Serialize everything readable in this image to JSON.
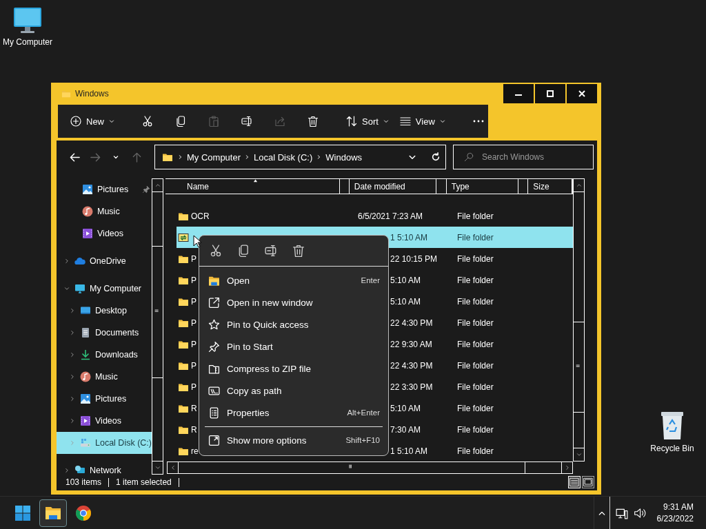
{
  "desktop_icons": [
    {
      "kind": "computer",
      "label": "My Computer"
    },
    {
      "kind": "recycle",
      "label": "Recycle Bin"
    }
  ],
  "window": {
    "title": "Windows"
  },
  "toolbar": [
    [
      {
        "kind": "new",
        "label": "New",
        "disabled": false
      }
    ],
    [
      {
        "kind": "cut",
        "disabled": false
      },
      {
        "kind": "copy",
        "disabled": false
      },
      {
        "kind": "paste",
        "disabled": true
      },
      {
        "kind": "rename",
        "disabled": false
      },
      {
        "kind": "share",
        "disabled": true
      },
      {
        "kind": "delete",
        "disabled": false
      }
    ],
    [
      {
        "kind": "sort",
        "label": "Sort",
        "disabled": false
      },
      {
        "kind": "view",
        "label": "View",
        "disabled": false
      }
    ],
    [
      {
        "kind": "more",
        "disabled": false
      }
    ]
  ],
  "nav_buttons": [
    {
      "kind": "back",
      "disabled": false
    },
    {
      "kind": "forward",
      "disabled": true
    },
    {
      "kind": "recent",
      "disabled": false
    },
    {
      "kind": "up",
      "disabled": true
    }
  ],
  "address": {
    "crumbs": [
      "My Computer",
      "Local Disk (C:)",
      "Windows"
    ]
  },
  "search": {
    "placeholder": "Search Windows"
  },
  "sidebar": {
    "pinned": [
      {
        "kind": "pictures",
        "label": "Pictures",
        "pinned": true
      },
      {
        "kind": "music",
        "label": "Music",
        "pinned": false
      },
      {
        "kind": "videos",
        "label": "Videos",
        "pinned": false
      }
    ],
    "tree": [
      {
        "kind": "onedrive",
        "label": "OneDrive",
        "expanded": false,
        "selected": false
      },
      {
        "kind": "computer",
        "label": "My Computer",
        "expanded": true,
        "selected": false,
        "children": [
          {
            "kind": "desktop",
            "label": "Desktop",
            "expanded": false,
            "selected": false
          },
          {
            "kind": "documents",
            "label": "Documents",
            "expanded": false,
            "selected": false
          },
          {
            "kind": "downloads",
            "label": "Downloads",
            "expanded": false,
            "selected": false
          },
          {
            "kind": "music",
            "label": "Music",
            "expanded": false,
            "selected": false
          },
          {
            "kind": "pictures",
            "label": "Pictures",
            "expanded": false,
            "selected": false
          },
          {
            "kind": "videos",
            "label": "Videos",
            "expanded": false,
            "selected": false
          },
          {
            "kind": "drive",
            "label": "Local Disk (C:)",
            "expanded": false,
            "selected": true
          }
        ]
      },
      {
        "kind": "network",
        "label": "Network",
        "expanded": false,
        "selected": false
      }
    ]
  },
  "table": {
    "columns": [
      {
        "label": "Name",
        "sorted": true
      },
      {
        "label": "Date modified",
        "sorted": false
      },
      {
        "label": "Type",
        "sorted": false
      },
      {
        "label": "Size",
        "sorted": false
      }
    ],
    "rows": [
      {
        "kind": "folder",
        "name": "OCR",
        "date": "6/5/2021 7:23 AM",
        "type": "File folder",
        "selected": false
      },
      {
        "kind": "sync-folder",
        "date": "1 5:10 AM",
        "type": "File folder",
        "selected": true,
        "date_covered": true
      },
      {
        "kind": "folder",
        "name": "P",
        "date": "22 10:15 PM",
        "type": "File folder",
        "selected": false,
        "date_covered": true
      },
      {
        "kind": "folder",
        "name": "P",
        "date": "5:10 AM",
        "type": "File folder",
        "selected": false,
        "date_covered": true
      },
      {
        "kind": "folder",
        "name": "P",
        "date": "5:10 AM",
        "type": "File folder",
        "selected": false,
        "date_covered": true
      },
      {
        "kind": "folder",
        "name": "P",
        "date": "22 4:30 PM",
        "type": "File folder",
        "selected": false,
        "date_covered": true
      },
      {
        "kind": "folder",
        "name": "P",
        "date": "22 9:30 AM",
        "type": "File folder",
        "selected": false,
        "date_covered": true
      },
      {
        "kind": "folder",
        "name": "P",
        "date": "22 4:30 PM",
        "type": "File folder",
        "selected": false,
        "date_covered": true
      },
      {
        "kind": "folder",
        "name": "P",
        "date": "22 3:30 PM",
        "type": "File folder",
        "selected": false,
        "date_covered": true
      },
      {
        "kind": "folder",
        "name": "R",
        "date": "5:10 AM",
        "type": "File folder",
        "selected": false,
        "date_covered": true
      },
      {
        "kind": "folder",
        "name": "R",
        "date": "7:30 AM",
        "type": "File folder",
        "selected": false,
        "date_covered": true
      },
      {
        "kind": "folder",
        "name": "re",
        "date": "1 5:10 AM",
        "type": "File folder",
        "selected": false,
        "date_covered": true
      }
    ]
  },
  "status_bar": {
    "items": [
      "103 items",
      "1 item selected"
    ],
    "views": [
      {
        "kind": "details",
        "selected": true
      },
      {
        "kind": "tiles",
        "selected": false
      }
    ]
  },
  "context_menu": {
    "quick_actions": [
      {
        "kind": "cut"
      },
      {
        "kind": "copy"
      },
      {
        "kind": "rename"
      },
      {
        "kind": "delete"
      }
    ],
    "sections": [
      [
        {
          "kind": "open",
          "label": "Open",
          "shortcut": "Enter"
        },
        {
          "kind": "new-window",
          "label": "Open in new window"
        },
        {
          "kind": "star",
          "label": "Pin to Quick access"
        },
        {
          "kind": "pin",
          "label": "Pin to Start"
        },
        {
          "kind": "zip",
          "label": "Compress to ZIP file"
        },
        {
          "kind": "path",
          "label": "Copy as path"
        },
        {
          "kind": "properties",
          "label": "Properties",
          "shortcut": "Alt+Enter"
        }
      ],
      [
        {
          "kind": "more-options",
          "label": "Show more options",
          "shortcut": "Shift+F10"
        }
      ]
    ]
  },
  "taskbar": {
    "apps": [
      {
        "kind": "start",
        "active": false
      },
      {
        "kind": "explorer",
        "active": true
      },
      {
        "kind": "chrome",
        "active": false
      }
    ],
    "time": "9:31 AM",
    "date": "6/23/2022"
  }
}
